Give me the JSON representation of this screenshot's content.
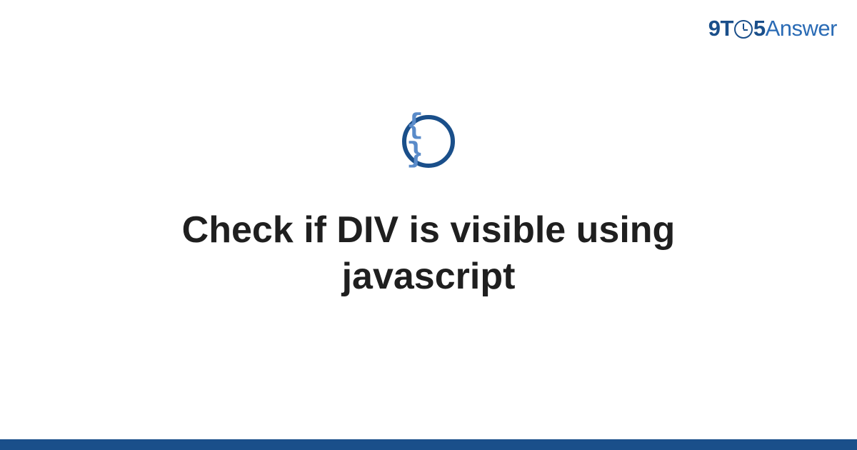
{
  "logo": {
    "prefix_9": "9",
    "prefix_t": "T",
    "suffix_5": "5",
    "answer": "Answer"
  },
  "icon": {
    "braces": "{ }",
    "semantic": "code-braces-icon"
  },
  "title": "Check if DIV is visible using javascript",
  "colors": {
    "brand": "#1a4f8a",
    "accent": "#5a8bc9",
    "text": "#1f1f1f"
  }
}
